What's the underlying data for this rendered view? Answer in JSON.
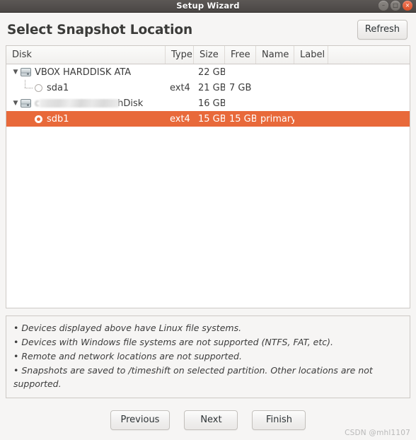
{
  "window": {
    "title": "Setup Wizard",
    "controls": [
      {
        "name": "minimize",
        "glyph": "–"
      },
      {
        "name": "maximize",
        "glyph": "□"
      },
      {
        "name": "close",
        "glyph": "×"
      }
    ],
    "colors": {
      "titlebar": "#4e4a47",
      "accent_selected_row": "#e8693a",
      "close_button": "#dc4f27",
      "window_background": "#f6f5f4"
    }
  },
  "header": {
    "title": "Select Snapshot Location",
    "refresh_label": "Refresh"
  },
  "table": {
    "columns": [
      {
        "key": "disk",
        "label": "Disk"
      },
      {
        "key": "type",
        "label": "Type"
      },
      {
        "key": "size",
        "label": "Size"
      },
      {
        "key": "free",
        "label": "Free"
      },
      {
        "key": "name",
        "label": "Name"
      },
      {
        "key": "label",
        "label": "Label"
      }
    ],
    "rows": [
      {
        "kind": "disk",
        "expander": "▼",
        "icon": "hard-disk-icon",
        "disk": "VBOX HARDDISK ATA",
        "type": "",
        "size": "22 GB",
        "free": "",
        "name": "",
        "label": "",
        "selected": false
      },
      {
        "kind": "partition",
        "icon": "radio-unselected-icon",
        "disk": "sda1",
        "type": "ext4",
        "size": "21 GB",
        "free": "7 GB",
        "name": "",
        "label": "",
        "selected": false
      },
      {
        "kind": "disk",
        "expander": "▼",
        "icon": "hard-disk-icon",
        "disk": "hDisk",
        "disk_redacted": true,
        "type": "",
        "size": "16 GB",
        "free": "",
        "name": "",
        "label": "",
        "selected": false
      },
      {
        "kind": "partition",
        "icon": "radio-selected-icon",
        "disk": "sdb1",
        "type": "ext4",
        "size": "15 GB",
        "free": "15 GB",
        "name": "primary",
        "label": "",
        "selected": true
      }
    ]
  },
  "notes": {
    "lines": [
      "• Devices displayed above have Linux file systems.",
      "• Devices with Windows file systems are not supported (NTFS, FAT, etc).",
      "• Remote and network locations are not supported.",
      "• Snapshots are saved to /timeshift on selected partition. Other locations are not supported."
    ]
  },
  "footer": {
    "previous_label": "Previous",
    "next_label": "Next",
    "finish_label": "Finish"
  },
  "watermark": {
    "text": "CSDN @mhl1107"
  }
}
